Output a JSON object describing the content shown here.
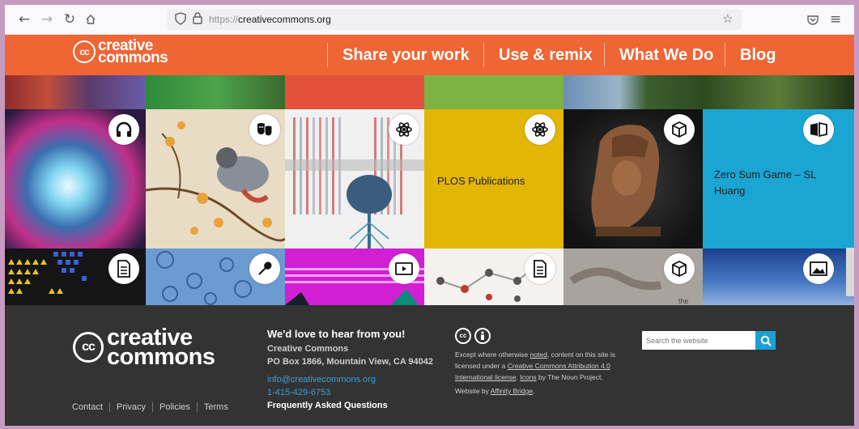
{
  "browser": {
    "url_proto": "https://",
    "url_host": "creativecommons.org"
  },
  "header": {
    "logo_line1": "creative",
    "logo_line2": "commons",
    "logo_cc": "cc",
    "nav": [
      "Share your work",
      "Use & remix",
      "What We Do",
      "Blog"
    ]
  },
  "tiles": {
    "plos": "PLOS Publications",
    "zero_sum_line1": "Zero Sum Game – SL",
    "zero_sum_line2": "Huang",
    "violin_caption": "the"
  },
  "footer": {
    "logo_line1": "creative",
    "logo_line2": "commons",
    "logo_cc": "cc",
    "links": [
      "Contact",
      "Privacy",
      "Policies",
      "Terms"
    ],
    "contact_heading": "We'd love to hear from you!",
    "org": "Creative Commons",
    "address": "PO Box 1866, Mountain View, CA 94042",
    "email": "info@creativecommons.org",
    "phone": "1-415-429-6753",
    "faq": "Frequently Asked Questions",
    "license_icon_cc": "cc",
    "license_text_1": "Except where otherwise ",
    "license_link_noted": "noted",
    "license_text_2": ", content on this site is licensed under a ",
    "license_link_cc": "Creative Commons Attribution 4.0 International license",
    "license_text_3": ". ",
    "license_link_icons": "Icons",
    "license_text_4": " by The Noun Project.",
    "website_by": "Website by ",
    "website_by_link": "Affinity Bridge",
    "website_by_end": ".",
    "search_placeholder": "Search the website"
  },
  "colors": {
    "header_orange": "#ef6534",
    "footer_bg": "#333333",
    "plos_yellow": "#e3b505",
    "zero_sum_blue": "#1ba5d3",
    "search_blue": "#1d9fd6"
  },
  "icons": [
    "back-arrow-icon",
    "forward-arrow-icon",
    "reload-icon",
    "home-icon",
    "shield-icon",
    "lock-icon",
    "star-icon",
    "pocket-icon",
    "menu-icon",
    "headphones-icon",
    "theater-masks-icon",
    "atom-icon",
    "cube-icon",
    "book-icon",
    "document-icon",
    "wrench-icon",
    "video-icon",
    "image-icon",
    "search-icon",
    "cc-license-icon",
    "attribution-icon"
  ]
}
